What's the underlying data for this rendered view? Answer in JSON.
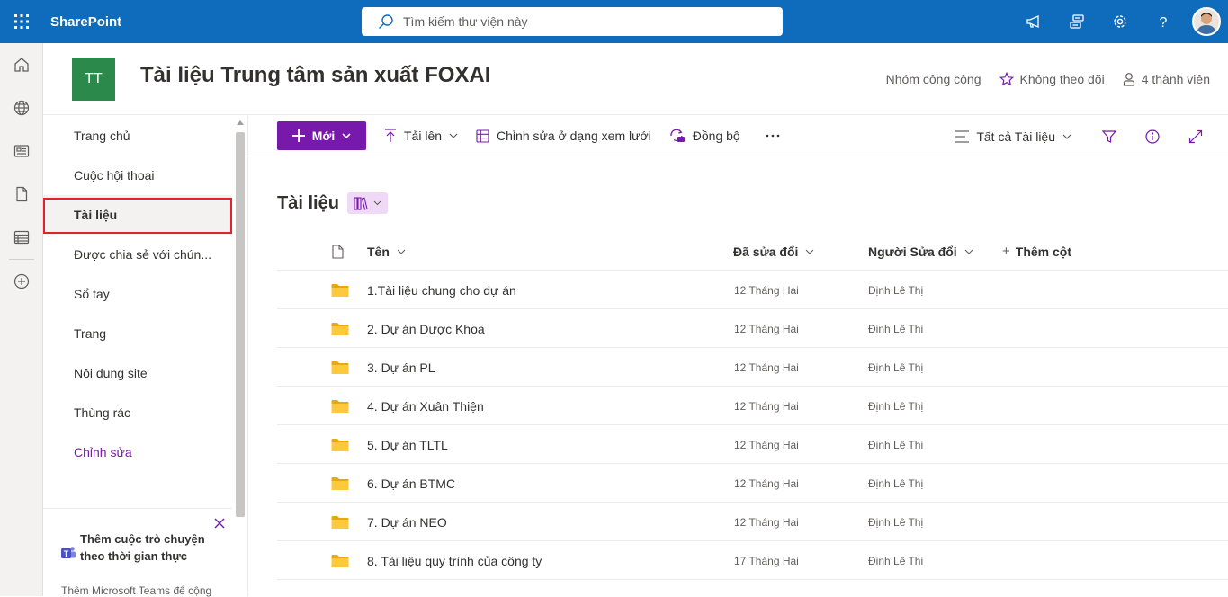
{
  "suitebar": {
    "brand": "SharePoint",
    "search_placeholder": "Tìm kiếm thư viện này",
    "icons": [
      "waffle-icon",
      "search-icon",
      "megaphone-icon",
      "feedback-icon",
      "settings-icon",
      "help-icon"
    ],
    "accent_color": "#0f6cbd"
  },
  "appbar": {
    "icons": [
      "home-icon",
      "globe-icon",
      "news-icon",
      "files-icon",
      "lists-icon",
      "add-icon"
    ]
  },
  "site": {
    "logo_text": "TT",
    "logo_color": "#2b8a4b",
    "title": "Tài liệu Trung tâm sản xuất FOXAI",
    "group_label": "Nhóm công cộng",
    "follow_label": "Không theo dõi",
    "members_label": "4 thành viên"
  },
  "nav": {
    "items": [
      {
        "label": "Trang chủ"
      },
      {
        "label": "Cuộc hội thoại"
      },
      {
        "label": "Tài liệu",
        "selected": true
      },
      {
        "label": "Được chia sẻ với chún..."
      },
      {
        "label": "Sổ tay"
      },
      {
        "label": "Trang"
      },
      {
        "label": "Nội dung site"
      },
      {
        "label": "Thùng rác"
      },
      {
        "label": "Chỉnh sửa"
      }
    ],
    "teams_promo": {
      "title": "Thêm cuộc trò chuyện theo thời gian thực",
      "description": "Thêm Microsoft Teams để cộng"
    }
  },
  "commandbar": {
    "new_label": "Mới",
    "upload_label": "Tải lên",
    "grid_edit_label": "Chỉnh sửa ở dạng xem lưới",
    "sync_label": "Đồng bộ",
    "view_label": "Tất cả Tài liệu",
    "accent_color": "#7719aa"
  },
  "library": {
    "title": "Tài liệu",
    "columns": {
      "name": "Tên",
      "modified": "Đã sửa đổi",
      "modified_by": "Người Sửa đổi",
      "add_column": "Thêm cột"
    },
    "rows": [
      {
        "name": "1.Tài liệu chung cho dự án",
        "modified": "12 Tháng Hai",
        "modified_by": "Định Lê Thị"
      },
      {
        "name": "2. Dự án Dược Khoa",
        "modified": "12 Tháng Hai",
        "modified_by": "Định Lê Thị"
      },
      {
        "name": "3. Dự án PL",
        "modified": "12 Tháng Hai",
        "modified_by": "Định Lê Thị"
      },
      {
        "name": "4. Dự án Xuân Thiện",
        "modified": "12 Tháng Hai",
        "modified_by": "Định Lê Thị"
      },
      {
        "name": "5. Dự án TLTL",
        "modified": "12 Tháng Hai",
        "modified_by": "Định Lê Thị"
      },
      {
        "name": "6. Dự án BTMC",
        "modified": "12 Tháng Hai",
        "modified_by": "Định Lê Thị"
      },
      {
        "name": "7. Dự án NEO",
        "modified": "12 Tháng Hai",
        "modified_by": "Định Lê Thị"
      },
      {
        "name": "8. Tài liệu quy trình của công ty",
        "modified": "17 Tháng Hai",
        "modified_by": "Định Lê Thị"
      }
    ]
  }
}
